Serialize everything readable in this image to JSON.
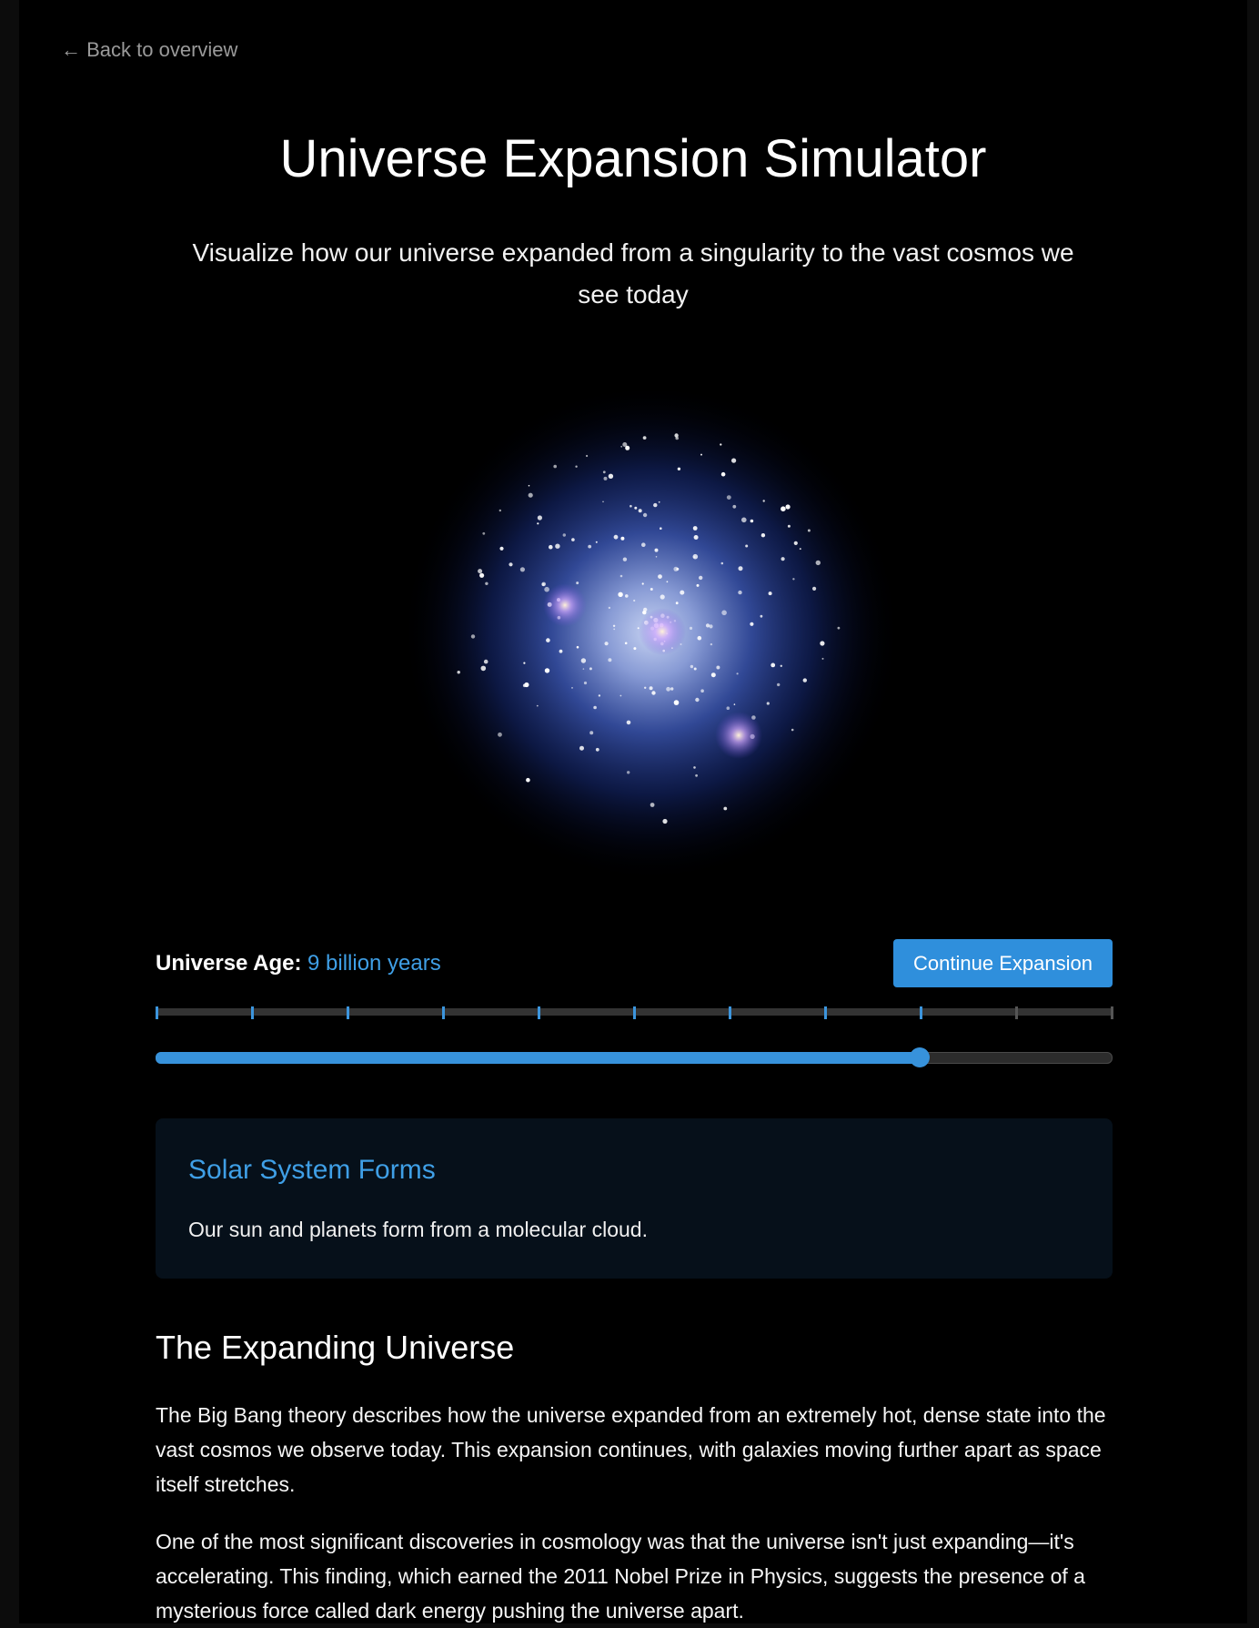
{
  "nav": {
    "back_label": "← Back to overview"
  },
  "header": {
    "title": "Universe Expansion Simulator",
    "subtitle": "Visualize how our universe expanded from a singularity to the vast cosmos we see today"
  },
  "colors": {
    "accent": "#3f9fe6",
    "button": "#2f8fdc",
    "card_bg": "#06101a",
    "page_bg": "#000000"
  },
  "controls": {
    "age_label": "Universe Age:",
    "age_value": "9 billion years",
    "continue_label": "Continue Expansion",
    "slider_progress": 0.8,
    "timeline_ticks_total": 11,
    "timeline_ticks_reached": 9
  },
  "event": {
    "title": "Solar System Forms",
    "description": "Our sun and planets form from a molecular cloud."
  },
  "article": {
    "heading": "The Expanding Universe",
    "paragraphs": [
      "The Big Bang theory describes how the universe expanded from an extremely hot, dense state into the vast cosmos we observe today. This expansion continues, with galaxies moving further apart as space itself stretches.",
      "One of the most significant discoveries in cosmology was that the universe isn't just expanding—it's accelerating. This finding, which earned the 2011 Nobel Prize in Physics, suggests the presence of a mysterious force called dark energy pushing the universe apart."
    ]
  }
}
